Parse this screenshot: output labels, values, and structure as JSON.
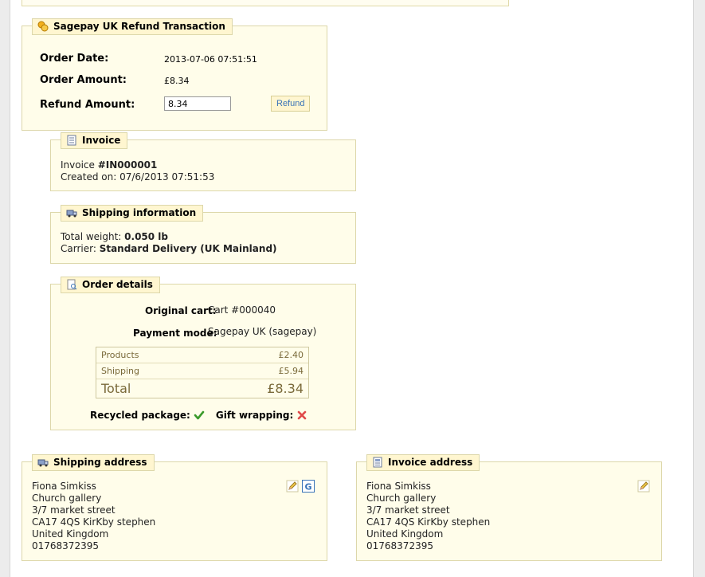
{
  "refund_panel": {
    "title": "Sagepay UK Refund Transaction",
    "order_date_label": "Order Date:",
    "order_date_value": "2013-07-06 07:51:51",
    "order_amount_label": "Order Amount:",
    "order_amount_value": "£8.34",
    "refund_amount_label": "Refund Amount:",
    "refund_amount_value": "8.34",
    "refund_button": "Refund"
  },
  "invoice": {
    "title": "Invoice",
    "invoice_prefix": "Invoice ",
    "invoice_number": "#IN000001",
    "created_on": "Created on: 07/6/2013 07:51:53"
  },
  "shipping_info": {
    "title": "Shipping information",
    "weight_label": "Total weight: ",
    "weight_value": "0.050 lb",
    "carrier_label": "Carrier: ",
    "carrier_value": "Standard Delivery (UK Mainland)"
  },
  "order_details": {
    "title": "Order details",
    "original_cart_label": "Original cart:",
    "original_cart_value": "Cart #000040",
    "payment_mode_label": "Payment mode:",
    "payment_mode_value": "Sagepay UK (sagepay)",
    "summary": [
      {
        "label": "Products",
        "value": "£2.40"
      },
      {
        "label": "Shipping",
        "value": "£5.94"
      }
    ],
    "total_label": "Total",
    "total_value": "£8.34",
    "recycled_label": "Recycled package:",
    "recycled_value": true,
    "gift_label": "Gift wrapping:",
    "gift_value": false
  },
  "shipping_address": {
    "title": "Shipping address",
    "lines": [
      "Fiona Simkiss",
      "Church gallery",
      "3/7 market street",
      "CA17 4QS KirKby stephen",
      "United Kingdom",
      "01768372395"
    ]
  },
  "invoice_address": {
    "title": "Invoice address",
    "lines": [
      "Fiona Simkiss",
      "Church gallery",
      "3/7 market street",
      "CA17 4QS KirKby stephen",
      "United Kingdom",
      "01768372395"
    ]
  },
  "colors": {
    "panel_bg": "#fffdea",
    "panel_border": "#ddd7aa",
    "legend_bg": "#fff6d0",
    "link": "#3a74b8",
    "check": "#3a9a2a",
    "cross": "#e04a4a"
  }
}
